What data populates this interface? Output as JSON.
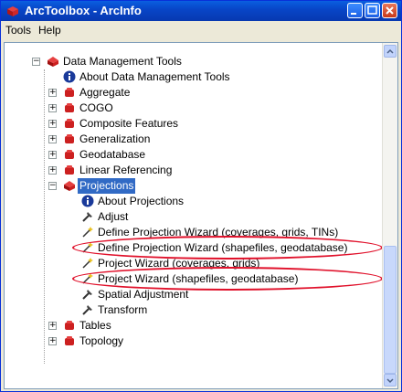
{
  "window": {
    "title": "ArcToolbox - ArcInfo"
  },
  "menu": {
    "items": [
      "Tools",
      "Help"
    ]
  },
  "tree": {
    "root": {
      "label": "Data Management Tools",
      "expander": "−"
    },
    "items": [
      {
        "label": "About Data Management Tools",
        "icon": "info-icon",
        "expander": ""
      },
      {
        "label": "Aggregate",
        "icon": "toolbox-icon",
        "expander": "+"
      },
      {
        "label": "COGO",
        "icon": "toolbox-icon",
        "expander": "+"
      },
      {
        "label": "Composite Features",
        "icon": "toolbox-icon",
        "expander": "+"
      },
      {
        "label": "Generalization",
        "icon": "toolbox-icon",
        "expander": "+"
      },
      {
        "label": "Geodatabase",
        "icon": "toolbox-icon",
        "expander": "+"
      },
      {
        "label": "Linear Referencing",
        "icon": "toolbox-icon",
        "expander": "+"
      },
      {
        "label": "Projections",
        "icon": "toolbox-open-icon",
        "expander": "−"
      },
      {
        "label": "Tables",
        "icon": "toolbox-icon",
        "expander": "+"
      },
      {
        "label": "Topology",
        "icon": "toolbox-icon",
        "expander": "+"
      }
    ],
    "projection_children": [
      {
        "label": "About Projections",
        "icon": "info-icon"
      },
      {
        "label": "Adjust",
        "icon": "hammer-icon"
      },
      {
        "label": "Define Projection Wizard (coverages, grids, TINs)",
        "icon": "wizard-icon"
      },
      {
        "label": "Define Projection Wizard (shapefiles, geodatabase)",
        "icon": "wizard-icon"
      },
      {
        "label": "Project Wizard (coverages, grids)",
        "icon": "wizard-icon"
      },
      {
        "label": "Project Wizard (shapefiles, geodatabase)",
        "icon": "wizard-icon"
      },
      {
        "label": "Spatial Adjustment",
        "icon": "hammer-icon"
      },
      {
        "label": "Transform",
        "icon": "hammer-icon"
      }
    ]
  },
  "colors": {
    "highlight_oval": "#e0102a",
    "selection": "#316ac5"
  }
}
